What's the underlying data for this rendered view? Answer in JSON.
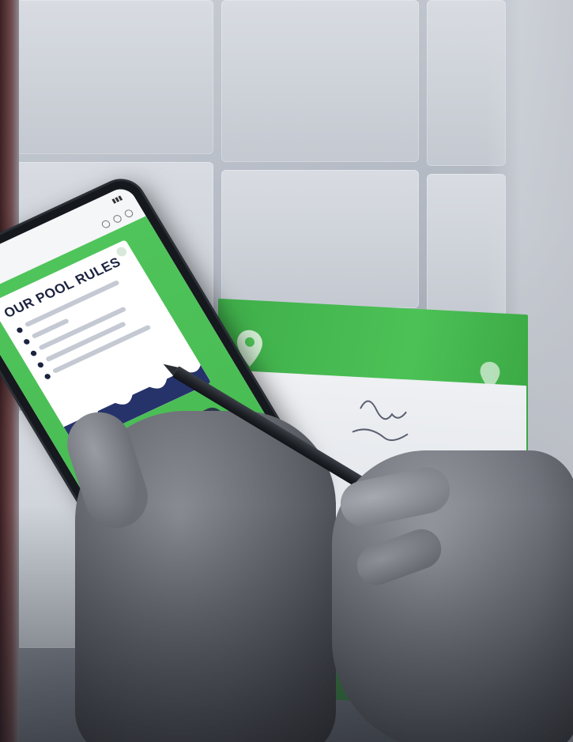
{
  "phone": {
    "card_title": "OUR POOL RULES",
    "rule_count": 5
  },
  "poster": {
    "banner_color": "#4cc256"
  },
  "colors": {
    "screen_green": "#4fc45a",
    "card_navy": "#1c2340"
  }
}
